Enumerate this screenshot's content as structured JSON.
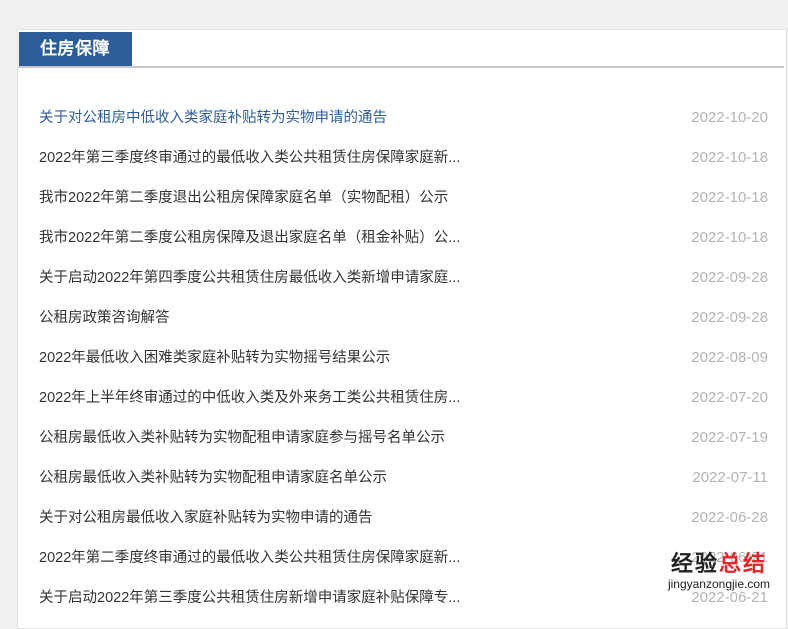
{
  "section": {
    "title": "住房保障"
  },
  "items": [
    {
      "title": "关于对公租房中低收入类家庭补贴转为实物申请的通告",
      "date": "2022-10-20"
    },
    {
      "title": "2022年第三季度终审通过的最低收入类公共租赁住房保障家庭新...",
      "date": "2022-10-18"
    },
    {
      "title": "我市2022年第二季度退出公租房保障家庭名单（实物配租）公示",
      "date": "2022-10-18"
    },
    {
      "title": "我市2022年第二季度公租房保障及退出家庭名单（租金补贴）公...",
      "date": "2022-10-18"
    },
    {
      "title": "关于启动2022年第四季度公共租赁住房最低收入类新增申请家庭...",
      "date": "2022-09-28"
    },
    {
      "title": "公租房政策咨询解答",
      "date": "2022-09-28"
    },
    {
      "title": "2022年最低收入困难类家庭补贴转为实物摇号结果公示",
      "date": "2022-08-09"
    },
    {
      "title": "2022年上半年终审通过的中低收入类及外来务工类公共租赁住房...",
      "date": "2022-07-20"
    },
    {
      "title": "公租房最低收入类补贴转为实物配租申请家庭参与摇号名单公示",
      "date": "2022-07-19"
    },
    {
      "title": "公租房最低收入类补贴转为实物配租申请家庭名单公示",
      "date": "2022-07-11"
    },
    {
      "title": "关于对公租房最低收入家庭补贴转为实物申请的通告",
      "date": "2022-06-28"
    },
    {
      "title": "2022年第二季度终审通过的最低收入类公共租赁住房保障家庭新...",
      "date": "2022-06-21"
    },
    {
      "title": "关于启动2022年第三季度公共租赁住房新增申请家庭补贴保障专...",
      "date": "2022-06-21"
    }
  ],
  "watermark": {
    "text_main": "经验",
    "text_accent": "总结",
    "url": "jingyanzongjie.com"
  },
  "colors": {
    "tab_background": "#2d5c9a",
    "first_item_link": "#2d5c9a",
    "item_text": "#333333",
    "date_text": "#b3b3b3",
    "watermark_accent": "#e0262b"
  }
}
